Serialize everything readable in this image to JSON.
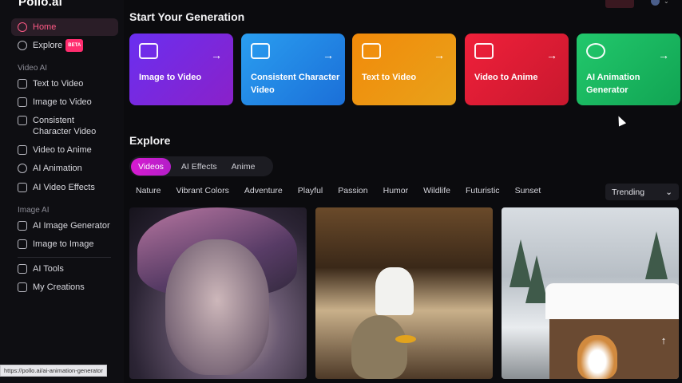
{
  "app": {
    "logo": "Pollo.ai"
  },
  "sidebar": {
    "home": "Home",
    "explore": "Explore",
    "explore_badge": "BETA",
    "section_video": "Video AI",
    "video_items": [
      {
        "label": "Text to Video",
        "icon": "text-video-icon"
      },
      {
        "label": "Image to Video",
        "icon": "image-video-icon"
      },
      {
        "label": "Consistent Character Video",
        "icon": "character-video-icon"
      },
      {
        "label": "Video to Anime",
        "icon": "anime-icon"
      },
      {
        "label": "AI Animation",
        "icon": "animation-icon"
      },
      {
        "label": "AI Video Effects",
        "icon": "effects-icon"
      }
    ],
    "section_image": "Image AI",
    "image_items": [
      {
        "label": "AI Image Generator",
        "icon": "image-generator-icon"
      },
      {
        "label": "Image to Image",
        "icon": "image-to-image-icon"
      }
    ],
    "tools": "AI Tools",
    "creations": "My Creations"
  },
  "status_url": "https://pollo.ai/ai-animation-generator",
  "main": {
    "generation_heading": "Start Your Generation",
    "cards": [
      {
        "label": "Image to Video",
        "arrow": "→"
      },
      {
        "label": "Consistent Character Video",
        "arrow": "→"
      },
      {
        "label": "Text to Video",
        "arrow": "→"
      },
      {
        "label": "Video to Anime",
        "arrow": "→"
      },
      {
        "label": "AI Animation Generator",
        "arrow": "→"
      }
    ],
    "explore_title": "Explore",
    "tabs": [
      "Videos",
      "AI Effects",
      "Anime"
    ],
    "filters": [
      "Nature",
      "Vibrant Colors",
      "Adventure",
      "Playful",
      "Passion",
      "Humor",
      "Wildlife",
      "Futuristic",
      "Sunset"
    ],
    "sort": {
      "value": "Trending",
      "chevron": "⌄"
    },
    "scroll_top": "↑"
  },
  "colors": {
    "accent": "#ff5a86",
    "tab_active": "#d71bd1",
    "background": "#0b0b0e"
  }
}
